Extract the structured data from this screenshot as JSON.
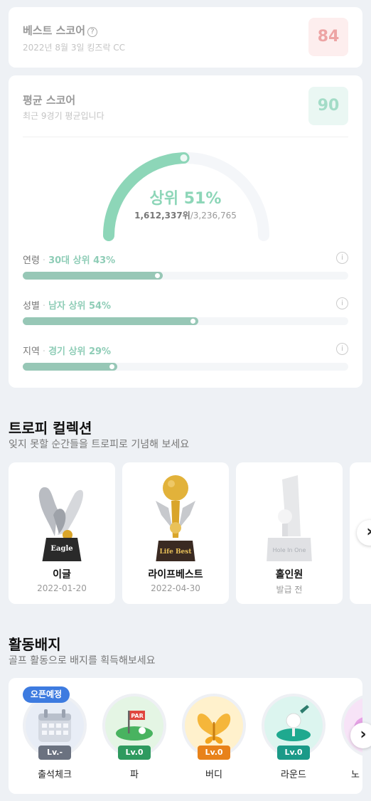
{
  "best": {
    "title": "베스트 스코어",
    "help": "?",
    "subtitle": "2022년 8월 3일 킹즈락 CC",
    "score": "84"
  },
  "average": {
    "title": "평균 스코어",
    "subtitle": "최근 9경기 평균입니다",
    "score": "90",
    "rank_label": "상위 51%",
    "rank_value": 51,
    "rank_position": "1,612,337위",
    "rank_total": "/3,236,765"
  },
  "stats": [
    {
      "label": "연령",
      "sep": "·",
      "value": "30대 상위 43%",
      "fill": 0.43,
      "info": "i"
    },
    {
      "label": "성별",
      "sep": "·",
      "value": "남자 상위 54%",
      "fill": 0.54,
      "info": "i"
    },
    {
      "label": "지역",
      "sep": "·",
      "value": "경기 상위 29%",
      "fill": 0.29,
      "info": "i"
    }
  ],
  "trophies": {
    "title": "트로피 컬렉션",
    "subtitle": "잊지 못할 순간들을 트로피로 기념해 보세요",
    "items": [
      {
        "name": "이글",
        "date": "2022-01-20",
        "plaque": "Eagle"
      },
      {
        "name": "라이프베스트",
        "date": "2022-04-30",
        "plaque": "Life Best"
      },
      {
        "name": "홀인원",
        "date": "발급 전",
        "plaque": "Hole In One"
      }
    ],
    "arrow": "›"
  },
  "badges": {
    "title": "활동배지",
    "subtitle": "골프 활동으로 배지를 획득해보세요",
    "open_tag": "오픈예정",
    "items": [
      {
        "name": "출석체크",
        "level": "Lv.-",
        "level_color": "#6b7280",
        "icon": "calendar-icon"
      },
      {
        "name": "파",
        "level": "Lv.0",
        "level_color": "#2e9a5f",
        "icon": "par-flag-icon",
        "flag_text": "PAR"
      },
      {
        "name": "버디",
        "level": "Lv.0",
        "level_color": "#e8821a",
        "icon": "butterfly-icon"
      },
      {
        "name": "라운드",
        "level": "Lv.0",
        "level_color": "#1b9a88",
        "icon": "golf-ball-tee-icon"
      },
      {
        "name": "노",
        "level": "",
        "level_color": "#b04fb0",
        "icon": "partial-badge-icon"
      }
    ],
    "arrow": "›"
  },
  "colors": {
    "accent_green": "#8dd6b8",
    "bar_fill": "#97c7b6",
    "best_score": "#eda4a4",
    "open_tag": "#3d7be0"
  }
}
